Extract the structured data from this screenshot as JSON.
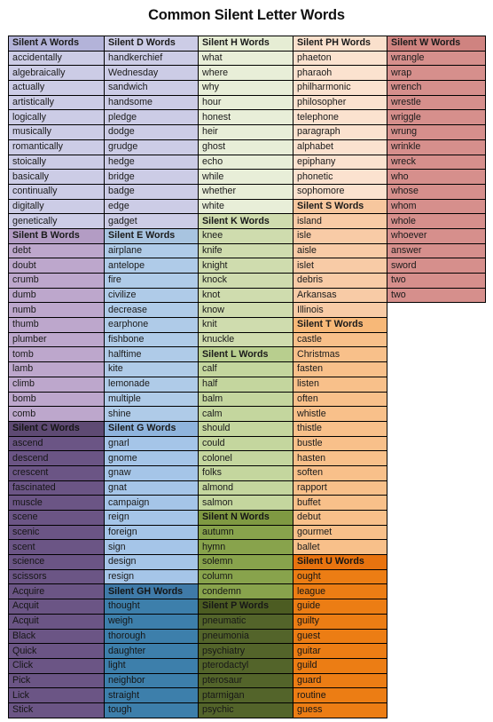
{
  "document": {
    "title": "Common Silent Letter Words"
  },
  "palette": {
    "silent_a_header": "#b3b3d9",
    "silent_a_cell": "#ccccE6",
    "silent_b_header": "#b39cc4",
    "silent_b_cell": "#bda7cc",
    "silent_c_header": "#5e4a73",
    "silent_c_cell": "#6b5585",
    "silent_d_header": "#ccccE6",
    "silent_d_cell": "#ccccE6",
    "silent_e_header": "#a8c4e0",
    "silent_e_cell": "#afcbe8",
    "silent_g_header": "#8fb4dd",
    "silent_g_cell": "#a5c5e8",
    "silent_gh_header": "#3f7aa8",
    "silent_gh_cell": "#3d7fab",
    "silent_h_header": "#e6edd4",
    "silent_h_cell": "#e8eed8",
    "silent_k_header": "#cfdcae",
    "silent_k_cell": "#cfdcae",
    "silent_l_header": "#b8ce8e",
    "silent_l_cell": "#c4d69e",
    "silent_n_header": "#7f9942",
    "silent_n_cell": "#88a34c",
    "silent_p_header": "#4c5c22",
    "silent_p_cell": "#53642a",
    "silent_ph_header": "#fae0cc",
    "silent_ph_cell": "#fbe2cf",
    "silent_s_header": "#f7c79e",
    "silent_s_cell": "#f8cba6",
    "silent_t_header": "#f7b878",
    "silent_t_cell": "#f8c08a",
    "silent_u_header": "#e8730f",
    "silent_u_cell": "#ec7d14",
    "silent_w_header": "#cf8380",
    "silent_w_cell": "#d68f8c",
    "grid_line": "#000000"
  },
  "columns": [
    {
      "id": "col-1",
      "sections": [
        {
          "heading": "Silent A Words",
          "header_color": "#b3b3d9",
          "cell_color": "#ccccE6",
          "text_color": "#1a1a1a",
          "words": [
            "accidentally",
            "algebraically",
            "actually",
            "artistically",
            "logically",
            "musically",
            "romantically",
            "stoically",
            "basically",
            "continually",
            "digitally",
            "genetically"
          ]
        },
        {
          "heading": "Silent B Words",
          "header_color": "#b39cc4",
          "cell_color": "#bda7cc",
          "text_color": "#1a1a1a",
          "words": [
            "debt",
            "doubt",
            "crumb",
            "dumb",
            "numb",
            "thumb",
            "plumber",
            "tomb",
            "lamb",
            "climb",
            "bomb",
            "comb"
          ]
        },
        {
          "heading": "Silent C Words",
          "header_color": "#5e4a73",
          "cell_color": "#6b5585",
          "text_color": "#151515",
          "words": [
            "ascend",
            "descend",
            "crescent",
            "fascinated",
            "muscle",
            "scene",
            "scenic",
            "scent",
            "science",
            "scissors",
            "Acquire",
            "Acquit",
            "Acquit",
            "Black",
            "Quick",
            "Click",
            "Pick",
            "Lick",
            "Stick"
          ]
        }
      ]
    },
    {
      "id": "col-2",
      "sections": [
        {
          "heading": "Silent D Words",
          "header_color": "#ccccE6",
          "cell_color": "#ccccE6",
          "text_color": "#1a1a1a",
          "words": [
            "handkerchief",
            "Wednesday",
            "sandwich",
            "handsome",
            "pledge",
            "dodge",
            "grudge",
            "hedge",
            "bridge",
            "badge",
            "edge",
            "gadget"
          ]
        },
        {
          "heading": "Silent E Words",
          "header_color": "#a8c4e0",
          "cell_color": "#afcbe8",
          "text_color": "#1a1a1a",
          "words": [
            "airplane",
            "antelope",
            "fire",
            "civilize",
            "decrease",
            "earphone",
            "fishbone",
            "halftime",
            "kite",
            "lemonade",
            "multiple",
            "shine"
          ]
        },
        {
          "heading": "Silent G Words",
          "header_color": "#8fb4dd",
          "cell_color": "#a5c5e8",
          "text_color": "#1a1a1a",
          "words": [
            "gnarl",
            "gnome",
            "gnaw",
            "gnat",
            "campaign",
            "reign",
            "foreign",
            "sign",
            "design",
            "resign"
          ]
        },
        {
          "heading": "Silent GH Words",
          "header_color": "#3f7aa8",
          "cell_color": "#3d7fab",
          "text_color": "#151515",
          "words": [
            "thought",
            "weigh",
            "thorough",
            "daughter",
            "light",
            "neighbor",
            "straight",
            "tough"
          ]
        }
      ]
    },
    {
      "id": "col-3",
      "sections": [
        {
          "heading": "Silent H Words",
          "header_color": "#e6edd4",
          "cell_color": "#e8eed8",
          "text_color": "#1a1a1a",
          "words": [
            "what",
            "where",
            "why",
            "hour",
            "honest",
            "heir",
            "ghost",
            "echo",
            "while",
            "whether",
            "white"
          ]
        },
        {
          "heading": "Silent K Words",
          "header_color": "#cfdcae",
          "cell_color": "#cfdcae",
          "text_color": "#1a1a1a",
          "words": [
            "knee",
            "knife",
            "knight",
            "knock",
            "knot",
            "know",
            "knit",
            "knuckle"
          ]
        },
        {
          "heading": "Silent L Words",
          "header_color": "#b8ce8e",
          "cell_color": "#c4d69e",
          "text_color": "#1a1a1a",
          "words": [
            "calf",
            "half",
            "balm",
            "calm",
            "should",
            "could",
            "colonel",
            "folks",
            "almond",
            "salmon"
          ]
        },
        {
          "heading": "Silent N Words",
          "header_color": "#7f9942",
          "cell_color": "#88a34c",
          "text_color": "#151515",
          "words": [
            "autumn",
            "hymn",
            "solemn",
            "column",
            "condemn"
          ]
        },
        {
          "heading": "Silent P Words",
          "header_color": "#4c5c22",
          "cell_color": "#53642a",
          "text_color": "#171717",
          "words": [
            "pneumatic",
            "pneumonia",
            "psychiatry",
            "pterodactyl",
            "pterosaur",
            "ptarmigan",
            "psychic"
          ]
        }
      ]
    },
    {
      "id": "col-4",
      "sections": [
        {
          "heading": "Silent PH Words",
          "header_color": "#fae0cc",
          "cell_color": "#fbe2cf",
          "text_color": "#1a1a1a",
          "words": [
            "phaeton",
            "pharaoh",
            "philharmonic",
            "philosopher",
            "telephone",
            "paragraph",
            "alphabet",
            "epiphany",
            "phonetic",
            "sophomore"
          ]
        },
        {
          "heading": "Silent S Words",
          "header_color": "#f7c79e",
          "cell_color": "#f8cba6",
          "text_color": "#1a1a1a",
          "words": [
            "island",
            "isle",
            "aisle",
            "islet",
            "debris",
            "Arkansas",
            "Illinois"
          ]
        },
        {
          "heading": "Silent T Words",
          "header_color": "#f7b878",
          "cell_color": "#f8c08a",
          "text_color": "#1a1a1a",
          "words": [
            "castle",
            "Christmas",
            "fasten",
            "listen",
            "often",
            "whistle",
            "thistle",
            "bustle",
            "hasten",
            "soften",
            "rapport",
            "buffet",
            "debut",
            "gourmet",
            "ballet"
          ]
        },
        {
          "heading": "Silent U Words",
          "header_color": "#e8730f",
          "cell_color": "#ec7d14",
          "text_color": "#151515",
          "words": [
            "ought",
            "league",
            "guide",
            "guilty",
            "guest",
            "guitar",
            "guild",
            "guard",
            "routine",
            "guess"
          ]
        }
      ]
    },
    {
      "id": "col-5",
      "sections": [
        {
          "heading": "Silent W Words",
          "header_color": "#cf8380",
          "cell_color": "#d68f8c",
          "text_color": "#1a1a1a",
          "words": [
            "wrangle",
            "wrap",
            "wrench",
            "wrestle",
            "wriggle",
            "wrung",
            "wrinkle",
            "wreck",
            "who",
            "whose",
            "whom",
            "whole",
            "whoever",
            "answer",
            "sword",
            "two",
            "two"
          ]
        }
      ]
    }
  ]
}
